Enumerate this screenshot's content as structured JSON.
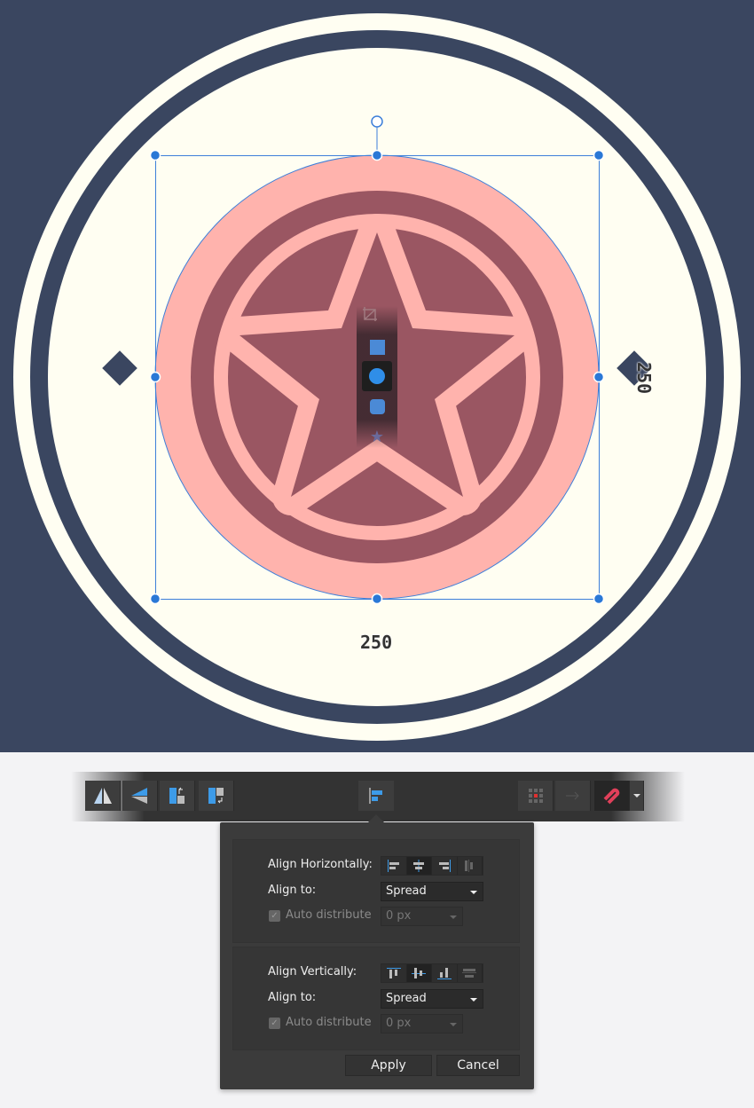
{
  "canvas": {
    "width_label": "250",
    "height_label": "250",
    "colors": {
      "background": "#3a4660",
      "cream": "#fffef2",
      "pink": "#ffb3ad",
      "maroon": "#9a5662",
      "selection": "#3d7fd9"
    }
  },
  "toolstrip": {
    "tools": [
      "crop-icon",
      "square-icon",
      "circle-icon",
      "rounded-square-icon",
      "star-icon"
    ],
    "active": "circle-icon"
  },
  "toolbar": {
    "left_buttons": [
      "flip-horizontal-icon",
      "flip-vertical-icon",
      "rotate-counterclockwise-icon",
      "rotate-clockwise-icon"
    ],
    "center_button": "align-icon",
    "right_buttons": [
      "snap-grid-icon",
      "arrow-icon",
      "snapping-magnet-icon"
    ]
  },
  "align_popup": {
    "horizontal": {
      "label": "Align Horizontally:",
      "align_to_label": "Align to:",
      "align_to_value": "Spread",
      "auto_distribute_label": "Auto distribute",
      "auto_distribute_checked": true,
      "distribute_value": "0 px"
    },
    "vertical": {
      "label": "Align Vertically:",
      "align_to_label": "Align to:",
      "align_to_value": "Spread",
      "auto_distribute_label": "Auto distribute",
      "auto_distribute_checked": true,
      "distribute_value": "0 px"
    },
    "apply_label": "Apply",
    "cancel_label": "Cancel"
  }
}
